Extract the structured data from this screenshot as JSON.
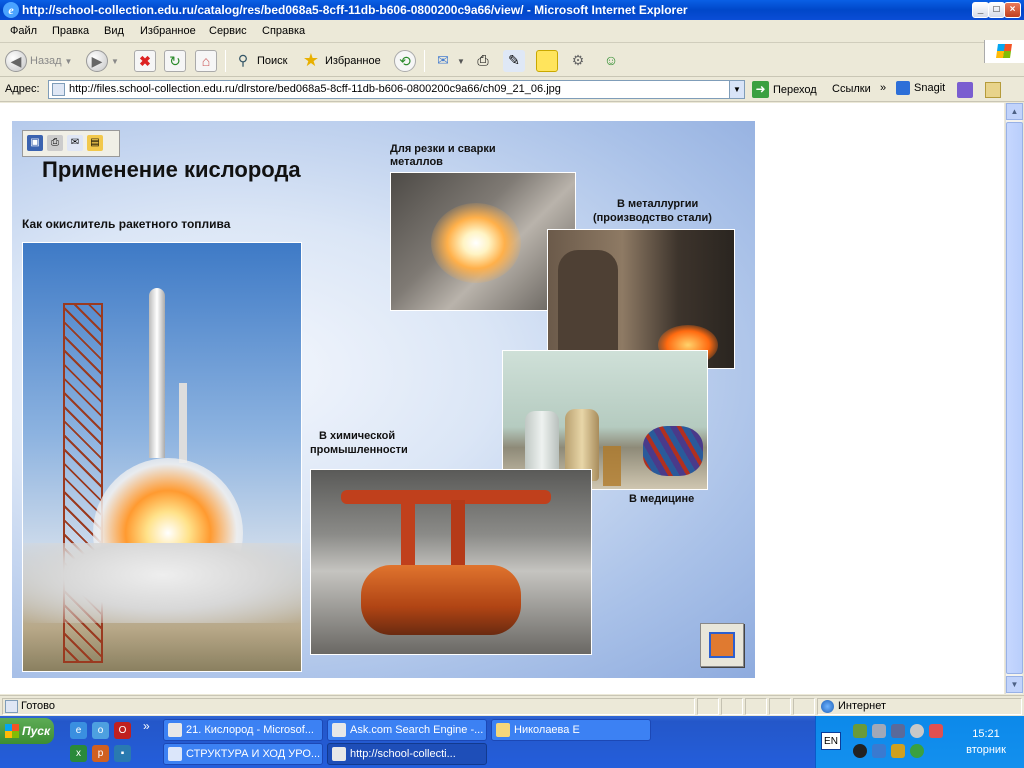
{
  "window": {
    "title": "http://school-collection.edu.ru/catalog/res/bed068a5-8cff-11db-b606-0800200c9a66/view/ - Microsoft Internet Explorer",
    "min": "_",
    "max": "□",
    "close": "×"
  },
  "menu": [
    "Файл",
    "Правка",
    "Вид",
    "Избранное",
    "Сервис",
    "Справка"
  ],
  "toolbar": {
    "back": "Назад",
    "search": "Поиск",
    "favorites": "Избранное"
  },
  "address": {
    "label": "Адрес:",
    "url": "http://files.school-collection.edu.ru/dlrstore/bed068a5-8cff-11db-b606-0800200c9a66/ch09_21_06.jpg",
    "go": "Переход",
    "links": "Ссылки",
    "snagit": "Snagit"
  },
  "slide": {
    "title": "Применение кислорода",
    "rocket_caption": "Как окислитель ракетного топлива",
    "cutting_caption_1": "Для резки и сварки",
    "cutting_caption_2": "металлов",
    "metal_caption_1": "В металлургии",
    "metal_caption_2": "(производство стали)",
    "chem_caption_1": "В химической",
    "chem_caption_2": "промышленности",
    "medicine_caption": "В медицине"
  },
  "status": {
    "text": "Готово",
    "zone": "Интернет"
  },
  "taskbar": {
    "start": "Пуск",
    "chevron": "»",
    "buttons": [
      "21. Кислород - Microsof...",
      "Ask.com Search Engine -...",
      "Николаева Е",
      "СТРУКТУРА И ХОД УРО...",
      "http://school-collecti..."
    ],
    "lang": "EN",
    "time": "15:21",
    "day": "вторник"
  },
  "colors": {
    "titlebar": "#0a5fe5",
    "taskbar": "#245edb",
    "tray": "#0c89ea",
    "start": "#3c8d33"
  }
}
